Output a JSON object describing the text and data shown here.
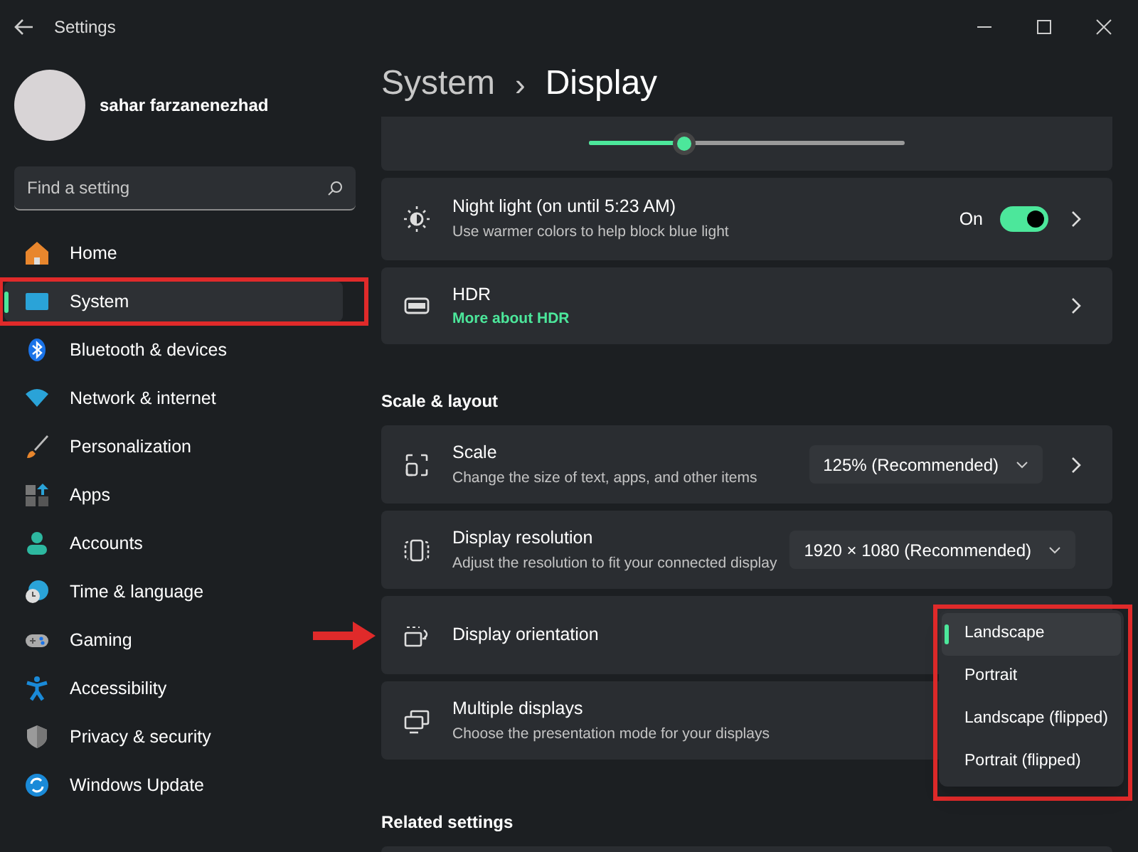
{
  "window": {
    "title": "Settings"
  },
  "profile": {
    "name": "sahar farzanenezhad"
  },
  "search": {
    "placeholder": "Find a setting"
  },
  "sidebar": {
    "items": [
      {
        "label": "Home",
        "selected": false,
        "highlighted": false
      },
      {
        "label": "System",
        "selected": true,
        "highlighted": true
      },
      {
        "label": "Bluetooth & devices",
        "selected": false,
        "highlighted": false
      },
      {
        "label": "Network & internet",
        "selected": false,
        "highlighted": false
      },
      {
        "label": "Personalization",
        "selected": false,
        "highlighted": false
      },
      {
        "label": "Apps",
        "selected": false,
        "highlighted": false
      },
      {
        "label": "Accounts",
        "selected": false,
        "highlighted": false
      },
      {
        "label": "Time & language",
        "selected": false,
        "highlighted": false
      },
      {
        "label": "Gaming",
        "selected": false,
        "highlighted": false
      },
      {
        "label": "Accessibility",
        "selected": false,
        "highlighted": false
      },
      {
        "label": "Privacy & security",
        "selected": false,
        "highlighted": false
      },
      {
        "label": "Windows Update",
        "selected": false,
        "highlighted": false
      }
    ]
  },
  "breadcrumb": {
    "parent": "System",
    "separator": "›",
    "current": "Display"
  },
  "brightness": {
    "level": 0.3
  },
  "cards": [
    {
      "kind": "toggle",
      "title": "Night light (on until 5:23 AM)",
      "subtitle": "Use warmer colors to help block blue light",
      "state_label": "On",
      "on": true
    },
    {
      "kind": "link",
      "title": "HDR",
      "link": "More about HDR"
    }
  ],
  "scale_section": {
    "heading": "Scale & layout",
    "cards": [
      {
        "kind": "dropdown",
        "title": "Scale",
        "subtitle": "Change the size of text, apps, and other items",
        "value": "125% (Recommended)",
        "chevron": true
      },
      {
        "kind": "dropdown",
        "title": "Display resolution",
        "subtitle": "Adjust the resolution to fit your connected display",
        "value": "1920 × 1080 (Recommended)",
        "chevron": false
      },
      {
        "kind": "menu",
        "title": "Display orientation",
        "arrow": true,
        "options": [
          {
            "label": "Landscape",
            "selected": true
          },
          {
            "label": "Portrait",
            "selected": false
          },
          {
            "label": "Landscape (flipped)",
            "selected": false
          },
          {
            "label": "Portrait (flipped)",
            "selected": false
          }
        ]
      },
      {
        "kind": "plain",
        "title": "Multiple displays",
        "subtitle": "Choose the presentation mode for your displays"
      }
    ]
  },
  "related": {
    "heading": "Related settings"
  }
}
